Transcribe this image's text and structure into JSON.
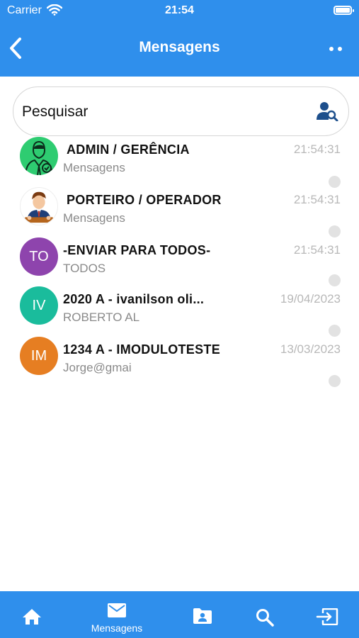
{
  "status_bar": {
    "carrier": "Carrier",
    "time": "21:54"
  },
  "header": {
    "title": "Mensagens"
  },
  "search": {
    "placeholder": "Pesquisar",
    "value": ""
  },
  "messages": [
    {
      "name": "ADMIN / GERÊNCIA",
      "subtitle": "Mensagens",
      "time": "21:54:31",
      "avatar": "admin-image"
    },
    {
      "name": "PORTEIRO / OPERADOR",
      "subtitle": "Mensagens",
      "time": "21:54:31",
      "avatar": "porteiro-image"
    },
    {
      "name": "-ENVIAR PARA TODOS-",
      "subtitle": "TODOS",
      "time": "21:54:31",
      "initials": "TO",
      "color": "#8e44ad"
    },
    {
      "name": "2020 A - ivanilson oli...",
      "subtitle": "ROBERTO AL",
      "time": "19/04/2023",
      "initials": "IV",
      "color": "#1abc9c"
    },
    {
      "name": "1234 A - IMODULOTESTE",
      "subtitle": "Jorge@gmai",
      "time": "13/03/2023",
      "initials": "IM",
      "color": "#e67e22"
    }
  ],
  "tabbar": {
    "tabs": [
      {
        "icon": "home-icon",
        "label": ""
      },
      {
        "icon": "envelope-icon",
        "label": "Mensagens",
        "active": true
      },
      {
        "icon": "folder-user-icon",
        "label": ""
      },
      {
        "icon": "search-icon",
        "label": ""
      },
      {
        "icon": "exit-icon",
        "label": ""
      }
    ]
  },
  "colors": {
    "primary": "#2f8fec",
    "unread_dot": "#e2e2e2"
  }
}
